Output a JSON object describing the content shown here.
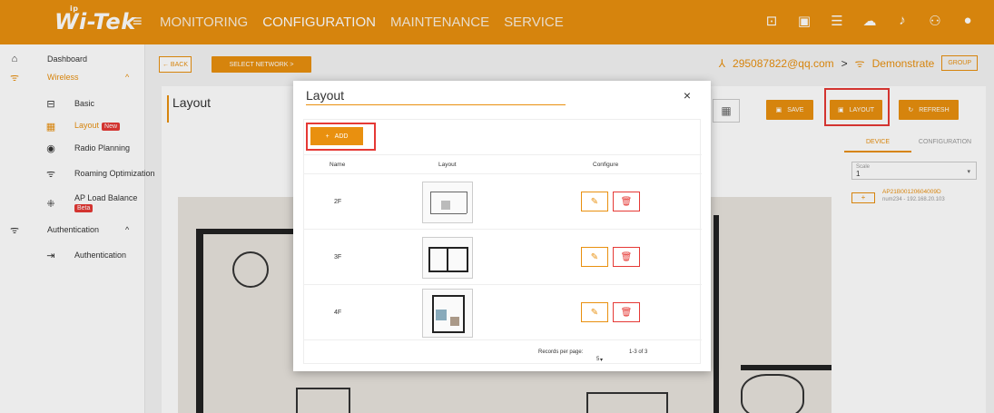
{
  "brand": {
    "logo": "Wi-Tek",
    "logo_small": "ip"
  },
  "nav": {
    "items": [
      "MONITORING",
      "CONFIGURATION",
      "MAINTENANCE",
      "SERVICE"
    ]
  },
  "sidebar": {
    "dashboard": "Dashboard",
    "wireless": "Wireless",
    "basic": "Basic",
    "layout": "Layout",
    "layout_badge": "New",
    "radio_planning": "Radio Planning",
    "roaming": "Roaming Optimization",
    "ap_load_balance": "AP Load Balance",
    "ap_badge": "Beta",
    "authentication_group": "Authentication",
    "authentication": "Authentication"
  },
  "toolbar": {
    "back": "← BACK",
    "select_network": "SELECT NETWORK  >",
    "account": "295087822@qq.com",
    "network": "Demonstrate",
    "group": "GROUP",
    "save": "SAVE",
    "layout": "LAYOUT",
    "refresh": "REFRESH"
  },
  "panel": {
    "title": "Layout"
  },
  "right_panel": {
    "tabs": [
      "DEVICE",
      "CONFIGURATION"
    ],
    "scale_label": "Scale",
    "scale_value": "1",
    "ap_name": "AP21B00120604009D",
    "ap_detail": "num234 - 192.168.20.103",
    "ap_add": "+"
  },
  "modal": {
    "title": "Layout",
    "close": "×",
    "add": "ADD",
    "columns": [
      "Name",
      "Layout",
      "Configure"
    ],
    "rows": [
      {
        "name": "2F"
      },
      {
        "name": "3F"
      },
      {
        "name": "4F"
      }
    ],
    "records_per_page_label": "Records per page:",
    "records_per_page": "5",
    "range": "1-3 of 3"
  },
  "colors": {
    "accent": "#e9900f",
    "danger": "#e53935"
  }
}
